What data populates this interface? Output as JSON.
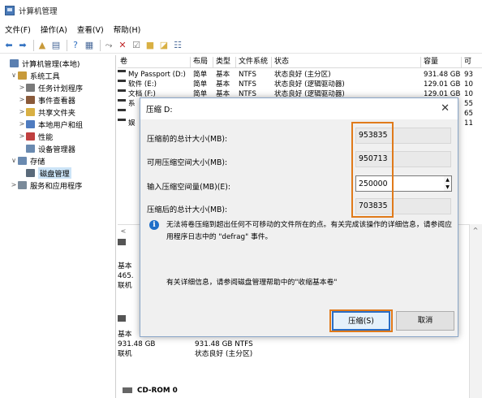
{
  "window": {
    "title": "计算机管理"
  },
  "menu": [
    "文件(F)",
    "操作(A)",
    "查看(V)",
    "帮助(H)"
  ],
  "tree": [
    {
      "label": "计算机管理(本地)",
      "indent": 0,
      "arrow": "",
      "icon": "computer-icon",
      "color": "#5a7fb0"
    },
    {
      "label": "系统工具",
      "indent": 1,
      "arrow": "∨",
      "icon": "tools-icon",
      "color": "#c89a3a"
    },
    {
      "label": "任务计划程序",
      "indent": 2,
      "arrow": ">",
      "icon": "clock-icon",
      "color": "#7a7a7a"
    },
    {
      "label": "事件查看器",
      "indent": 2,
      "arrow": ">",
      "icon": "event-viewer-icon",
      "color": "#8a5a3a"
    },
    {
      "label": "共享文件夹",
      "indent": 2,
      "arrow": ">",
      "icon": "shared-folder-icon",
      "color": "#d9b043"
    },
    {
      "label": "本地用户和组",
      "indent": 2,
      "arrow": ">",
      "icon": "users-icon",
      "color": "#4f7cc0"
    },
    {
      "label": "性能",
      "indent": 2,
      "arrow": ">",
      "icon": "performance-icon",
      "color": "#c04040"
    },
    {
      "label": "设备管理器",
      "indent": 2,
      "arrow": "",
      "icon": "device-manager-icon",
      "color": "#6a8ab0"
    },
    {
      "label": "存储",
      "indent": 1,
      "arrow": "∨",
      "icon": "storage-icon",
      "color": "#6a8ab0"
    },
    {
      "label": "磁盘管理",
      "indent": 2,
      "arrow": "",
      "icon": "disk-icon",
      "color": "#5a6a7a",
      "selected": true
    },
    {
      "label": "服务和应用程序",
      "indent": 1,
      "arrow": ">",
      "icon": "services-icon",
      "color": "#7a8a9a"
    }
  ],
  "volumes": {
    "headers": [
      "卷",
      "布局",
      "类型",
      "文件系统",
      "状态",
      "容量",
      "可"
    ],
    "rows": [
      [
        "My Passport (D:)",
        "简单",
        "基本",
        "NTFS",
        "状态良好 (主分区)",
        "931.48 GB",
        "93"
      ],
      [
        "软件 (E:)",
        "简单",
        "基本",
        "NTFS",
        "状态良好 (逻辑驱动器)",
        "129.01 GB",
        "10"
      ],
      [
        "文档 (F:)",
        "简单",
        "基本",
        "NTFS",
        "状态良好 (逻辑驱动器)",
        "129.01 GB",
        "10"
      ],
      [
        "系",
        "",
        "",
        "",
        "",
        "",
        "55"
      ],
      [
        "",
        "",
        "",
        "",
        "",
        "",
        "65"
      ],
      [
        "娱",
        "",
        "",
        "",
        "",
        "",
        "11"
      ]
    ]
  },
  "disk_pane": {
    "disk0": {
      "lines": [
        "基本",
        "465.",
        "联机"
      ]
    },
    "disk1": {
      "lines": [
        "基本",
        "931.48 GB",
        "联机"
      ],
      "part_lines": [
        "931.48 GB NTFS",
        "状态良好 (主分区)"
      ]
    },
    "cdrom": "CD-ROM 0"
  },
  "dialog": {
    "title": "压缩 D:",
    "rows": [
      {
        "label": "压缩前的总计大小(MB):",
        "value": "953835"
      },
      {
        "label": "可用压缩空间大小(MB):",
        "value": "950713"
      },
      {
        "label": "输入压缩空间量(MB)(E):",
        "value": "250000"
      },
      {
        "label": "压缩后的总计大小(MB):",
        "value": "703835"
      }
    ],
    "info": "无法将卷压缩到超出任何不可移动的文件所在的点。有关完成该操作的详细信息，请参阅应用程序日志中的 \"defrag\" 事件。",
    "more_info": "有关详细信息，请参阅磁盘管理帮助中的\"收缩基本卷\"",
    "compress_button": "压缩(S)",
    "cancel_button": "取消"
  },
  "colors": {
    "highlight": "#e07a1a",
    "partition_bar": "#1f3f9a"
  }
}
